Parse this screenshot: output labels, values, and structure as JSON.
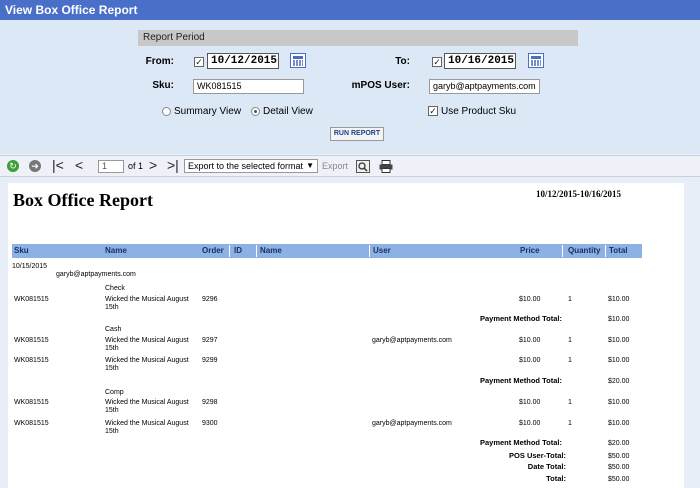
{
  "window": {
    "title": "View Box Office Report"
  },
  "params": {
    "header": "Report Period",
    "from_label": "From:",
    "from_value": "10/12/2015",
    "to_label": "To:",
    "to_value": "10/16/2015",
    "sku_label": "Sku:",
    "sku_value": "WK081515",
    "mpos_label": "mPOS User:",
    "mpos_value": "garyb@aptpayments.com",
    "summary_label": "Summary View",
    "detail_label": "Detail View",
    "use_sku_label": "Use Product Sku",
    "selected_view": "detail",
    "run_label": "RUN REPORT"
  },
  "toolbar": {
    "page_value": "1",
    "of_text": "of 1",
    "export_format": "Export to the selected format",
    "export_label": "Export"
  },
  "report": {
    "title": "Box Office Report",
    "date_range": "10/12/2015-10/16/2015",
    "columns": [
      "Sku",
      "Name",
      "Order",
      "ID",
      "Name",
      "User",
      "Price",
      "Quantity",
      "Total"
    ],
    "date_group": "10/15/2015",
    "user_group": "garyb@aptpayments.com",
    "groups": [
      {
        "method": "Check",
        "rows": [
          {
            "sku": "WK081515",
            "name1": "Wicked the Musical August",
            "name2": "15th",
            "order": "9296",
            "user": "",
            "price": "$10.00",
            "qty": "1",
            "total": "$10.00"
          }
        ],
        "total_label": "Payment Method Total:",
        "total": "$10.00"
      },
      {
        "method": "Cash",
        "rows": [
          {
            "sku": "WK081515",
            "name1": "Wicked the Musical August",
            "name2": "15th",
            "order": "9297",
            "user": "garyb@aptpayments.com",
            "price": "$10.00",
            "qty": "1",
            "total": "$10.00"
          },
          {
            "sku": "WK081515",
            "name1": "Wicked the Musical August",
            "name2": "15th",
            "order": "9299",
            "user": "",
            "price": "$10.00",
            "qty": "1",
            "total": "$10.00"
          }
        ],
        "total_label": "Payment Method Total:",
        "total": "$20.00"
      },
      {
        "method": "Comp",
        "rows": [
          {
            "sku": "WK081515",
            "name1": "Wicked the Musical August",
            "name2": "15th",
            "order": "9298",
            "user": "",
            "price": "$10.00",
            "qty": "1",
            "total": "$10.00"
          },
          {
            "sku": "WK081515",
            "name1": "Wicked the Musical August",
            "name2": "15th",
            "order": "9300",
            "user": "garyb@aptpayments.com",
            "price": "$10.00",
            "qty": "1",
            "total": "$10.00"
          }
        ],
        "total_label": "Payment Method Total:",
        "total": "$20.00"
      }
    ],
    "summary": [
      {
        "label": "POS User-Total:",
        "value": "$50.00"
      },
      {
        "label": "Date Total:",
        "value": "$50.00"
      },
      {
        "label": "Total:",
        "value": "$50.00"
      }
    ]
  },
  "colors": {
    "titlebar": "#4a6fc9",
    "params_bg": "#dde8f7",
    "table_header": "#8db1e5"
  },
  "icons": [
    "calendar-icon",
    "first-page-icon",
    "prev-page-icon",
    "next-page-icon",
    "last-page-icon",
    "refresh-icon",
    "back-icon",
    "search-icon",
    "print-icon"
  ]
}
